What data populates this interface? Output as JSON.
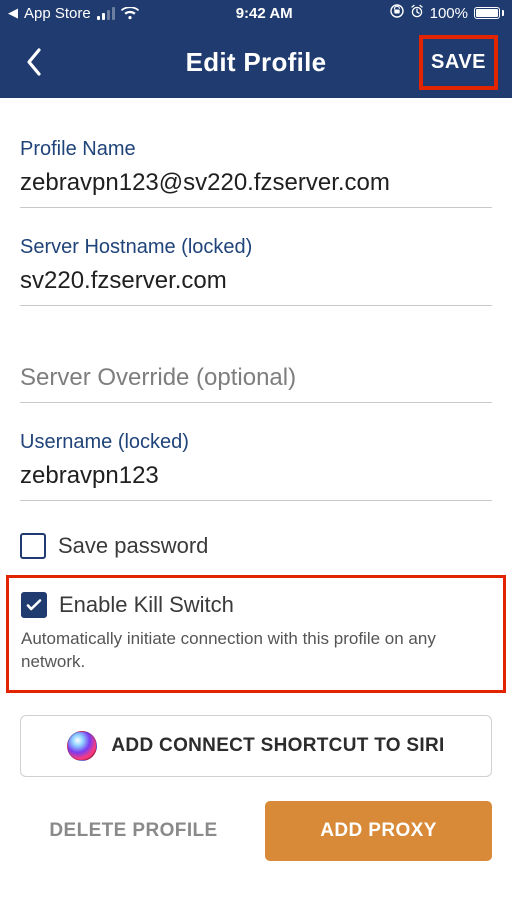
{
  "status_bar": {
    "back_app": "App Store",
    "time": "9:42 AM",
    "battery_pct": "100%"
  },
  "nav": {
    "title": "Edit Profile",
    "save_label": "SAVE"
  },
  "fields": {
    "profile_name": {
      "label": "Profile Name",
      "value": "zebravpn123@sv220.fzserver.com"
    },
    "server_hostname": {
      "label": "Server Hostname (locked)",
      "value": "sv220.fzserver.com"
    },
    "server_override": {
      "placeholder": "Server Override (optional)"
    },
    "username": {
      "label": "Username (locked)",
      "value": "zebravpn123"
    }
  },
  "save_password": {
    "label": "Save password",
    "checked": false
  },
  "kill_switch": {
    "label": "Enable Kill Switch",
    "checked": true,
    "description": "Automatically initiate connection with this profile on any network."
  },
  "siri": {
    "label": "ADD CONNECT SHORTCUT TO SIRI"
  },
  "bottom": {
    "delete_label": "DELETE PROFILE",
    "proxy_label": "ADD PROXY"
  },
  "highlights": {
    "save": true,
    "kill_switch": true
  },
  "colors": {
    "navy": "#1f3b6f",
    "orange": "#d88a38",
    "highlight": "#e32400"
  }
}
